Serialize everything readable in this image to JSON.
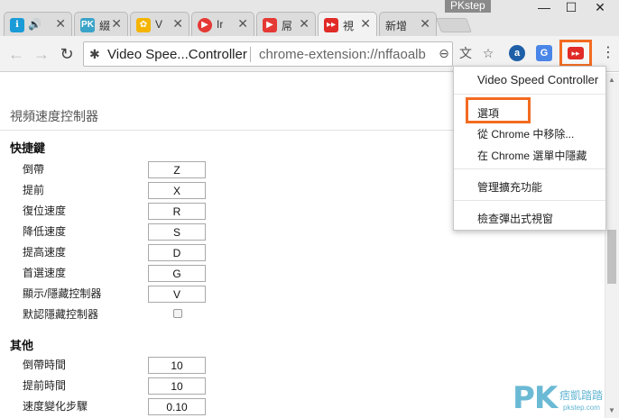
{
  "browser": {
    "tabs": [
      {
        "title": "",
        "icon": "speaker-icon",
        "favicon_color": "#1a9bd7"
      },
      {
        "title": "綴",
        "icon": "pk-icon",
        "favicon_color": "#3aa3c8",
        "favicon_text": "PK"
      },
      {
        "title": "V",
        "icon": "photos-icon",
        "favicon_color": "#f4b400"
      },
      {
        "title": "Ir",
        "icon": "play-icon",
        "favicon_color": "#e53935"
      },
      {
        "title": "屌",
        "icon": "youtube-icon",
        "favicon_color": "#e53935"
      },
      {
        "title": "視",
        "icon": "video-speed-icon",
        "favicon_color": "#e02b27"
      },
      {
        "title": "新增",
        "icon": "",
        "favicon_color": ""
      }
    ],
    "watermark_top": "PKstep",
    "window_controls": {
      "minimize": "—",
      "maximize": "☐",
      "close": "✕"
    }
  },
  "toolbar": {
    "omnibox_title": "Video Spee...Controller",
    "omnibox_url": "chrome-extension://nffaoalb"
  },
  "page": {
    "title": "視頻速度控制器",
    "shortcuts_heading": "快捷鍵",
    "shortcuts": [
      {
        "label": "倒帶",
        "value": "Z"
      },
      {
        "label": "提前",
        "value": "X"
      },
      {
        "label": "復位速度",
        "value": "R"
      },
      {
        "label": "降低速度",
        "value": "S"
      },
      {
        "label": "提高速度",
        "value": "D"
      },
      {
        "label": "首選速度",
        "value": "G"
      },
      {
        "label": "顯示/隱藏控制器",
        "value": "V"
      }
    ],
    "default_hide_label": "默認隱藏控制器",
    "other_heading": "其他",
    "other": [
      {
        "label": "倒帶時間",
        "value": "10"
      },
      {
        "label": "提前時間",
        "value": "10"
      },
      {
        "label": "速度變化步驟",
        "value": "0.10"
      }
    ]
  },
  "menu": {
    "title": "Video Speed Controller",
    "options": "選項",
    "remove": "從 Chrome 中移除...",
    "hide": "在 Chrome 選單中隱藏",
    "manage": "管理擴充功能",
    "inspect": "檢查彈出式視窗"
  },
  "watermark_bottom": {
    "brand": "PK",
    "subtitle": "痞凱踏踏",
    "url": "pkstep.com"
  },
  "colors": {
    "highlight": "#f36b21",
    "vsc_red": "#e02b27"
  }
}
